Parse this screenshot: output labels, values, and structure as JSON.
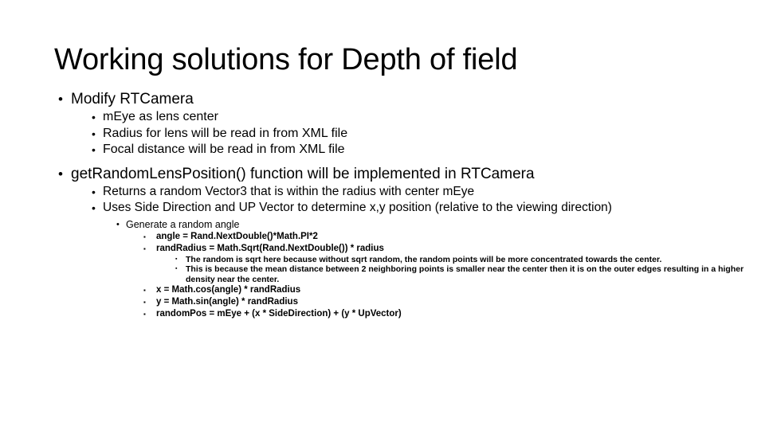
{
  "slide": {
    "title": "Working solutions for Depth of field",
    "background_color": "#ffffff",
    "text_color": "#000000",
    "bullets": {
      "round": "•",
      "square": "▪"
    },
    "content": {
      "modify_camera": "Modify RTCamera",
      "m_eye": "mEye as lens center",
      "radius_xml": "Radius for lens will be read in from XML file",
      "focal_xml": "Focal distance will be read in from XML file",
      "get_random_lens_position": "getRandomLensPosition() function will be implemented in RTCamera",
      "returns_vector3": "Returns a random Vector3 that is within the radius with center mEye",
      "uses_side_direction": "Uses Side Direction and UP Vector to determine x,y position (relative to the viewing direction)",
      "generate_random_angle": "Generate a random angle",
      "angle_formula": "angle = Rand.NextDouble()*Math.PI*2",
      "rand_radius_formula": "randRadius = Math.Sqrt(Rand.NextDouble()) * radius",
      "sqrt_reason": "The random is sqrt here because without sqrt random, the random points will be more concentrated towards the center.",
      "mean_distance_reason": "This is because the mean distance between 2 neighboring points is smaller near the center then it is on the outer edges resulting in a higher density near the center.",
      "x_formula": "x = Math.cos(angle) * randRadius",
      "y_formula": "y = Math.sin(angle) * randRadius",
      "random_pos_formula": "randomPos = mEye + (x * SideDirection) + (y * UpVector)"
    }
  }
}
